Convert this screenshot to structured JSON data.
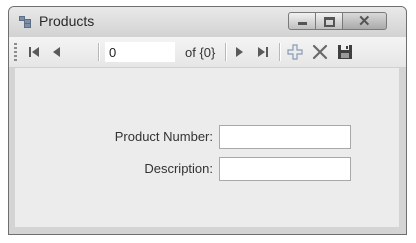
{
  "window": {
    "title": "Products",
    "icon": "form-icon",
    "controls": [
      "minimize-icon",
      "maximize-icon",
      "close-icon"
    ]
  },
  "navigator": {
    "first_icon": "move-first-icon",
    "previous_icon": "move-previous-icon",
    "position_value": "0",
    "count_label": "of {0}",
    "next_icon": "move-next-icon",
    "last_icon": "move-last-icon",
    "add_icon": "add-new-icon",
    "delete_icon": "delete-icon",
    "save_icon": "save-icon"
  },
  "form": {
    "product_number_label": "Product Number:",
    "product_number_value": "",
    "description_label": "Description:",
    "description_value": ""
  },
  "colors": {
    "toolbar_icon": "#5a5a5a",
    "add_icon": "#8a9bb0"
  }
}
